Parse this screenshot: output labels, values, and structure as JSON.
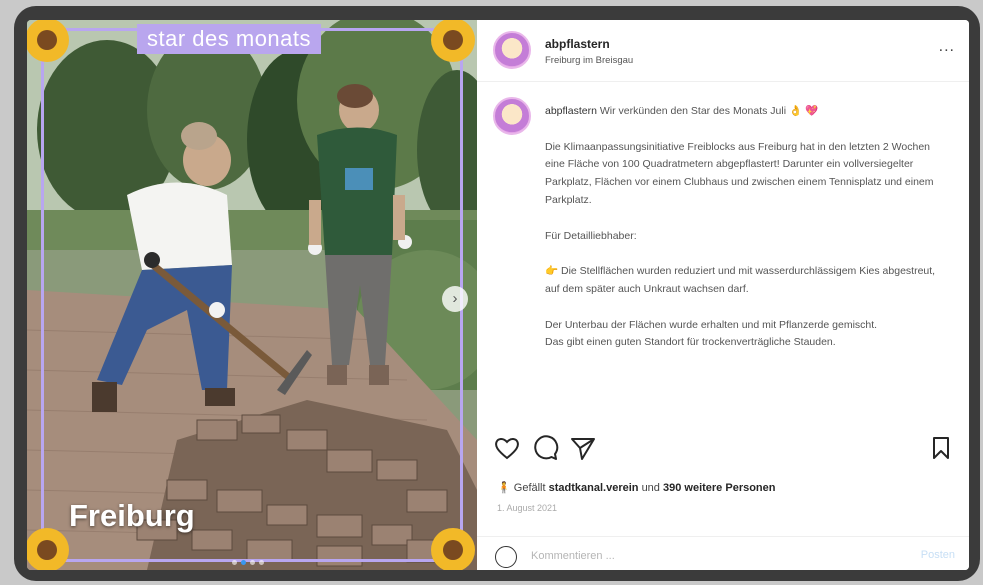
{
  "photo": {
    "banner_text": "star des monats",
    "location_overlay": "Freiburg",
    "next_glyph": "›",
    "carousel_dots": 4,
    "carousel_active": 1
  },
  "post": {
    "username": "abpflastern",
    "location": "Freiburg im Breisgau",
    "more_glyph": "...",
    "caption_user": "abpflastern",
    "caption_intro": "Wir verkünden den Star des Monats Juli 👌 💖",
    "paragraphs": [
      "Die Klimaanpassungsinitiative Freiblocks aus Freiburg hat in den letzten 2 Wochen eine Fläche von 100 Quadratmetern abgepflastert! Darunter ein vollversiegelter Parkplatz, Flächen vor einem Clubhaus und zwischen einem Tennisplatz und einem Parkplatz.",
      "Für Detailliebhaber:",
      "👉 Die Stellflächen wurden reduziert und mit wasserdurchlässigem Kies abgestreut, auf dem später auch Unkraut wachsen darf.",
      "Der Unterbau der Flächen wurde erhalten und mit Pflanzerde gemischt.",
      "Das gibt einen guten Standort für trockenverträgliche Stauden."
    ]
  },
  "likes": {
    "prefix": "Gefällt",
    "user": "stadtkanal.verein",
    "middle": "und",
    "others": "390 weitere Personen"
  },
  "date": "1. August 2021",
  "comment": {
    "placeholder": "Kommentieren ...",
    "post_label": "Posten"
  },
  "icons": {
    "like": "heart-icon",
    "comment": "comment-icon",
    "share": "share-icon",
    "save": "bookmark-icon",
    "emoji": "emoji-icon"
  },
  "colors": {
    "banner": "#b9a6ee",
    "border": "#b8a6f0",
    "frame": "#3b3b3b"
  }
}
